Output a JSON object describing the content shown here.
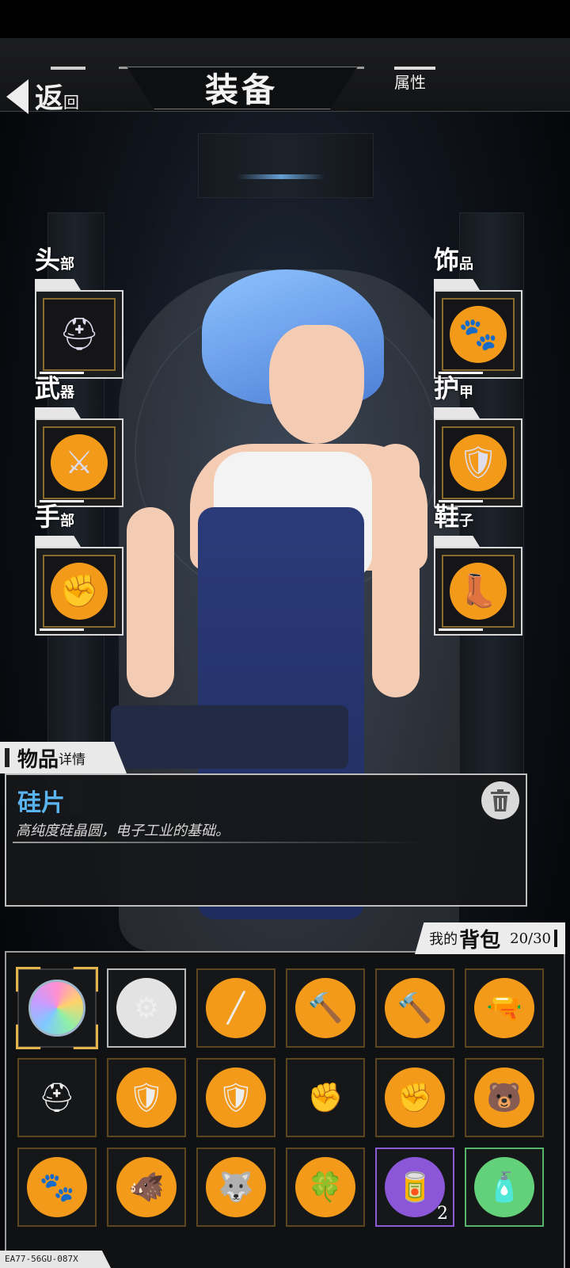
{
  "header": {
    "title": "装备",
    "back_big": "返",
    "back_small": "回",
    "attr_tab": "属性"
  },
  "slots": [
    {
      "big": "头",
      "small": "部",
      "icon_name": "helmet-icon",
      "orb": "none",
      "glyph": "⛑"
    },
    {
      "big": "武",
      "small": "器",
      "icon_name": "lightsaber-icon",
      "orb": "orange",
      "glyph": "⚔"
    },
    {
      "big": "手",
      "small": "部",
      "icon_name": "gauntlet-icon",
      "orb": "orange",
      "glyph": "✊"
    },
    {
      "big": "饰",
      "small": "品",
      "icon_name": "mole-charm-icon",
      "orb": "orange",
      "glyph": "🐾"
    },
    {
      "big": "护",
      "small": "甲",
      "icon_name": "armor-vest-icon",
      "orb": "orange",
      "glyph": "🛡"
    },
    {
      "big": "鞋",
      "small": "子",
      "icon_name": "boots-icon",
      "orb": "orange",
      "glyph": "👢"
    }
  ],
  "detail": {
    "tab_big": "物品",
    "tab_small": "详情",
    "name": "硅片",
    "description": "高纯度硅晶圆，电子工业的基础。"
  },
  "backpack": {
    "my": "我的",
    "label": "背包",
    "capacity": "20/30",
    "items": [
      {
        "icon_name": "silicon-wafer-icon",
        "rarity": "selected",
        "bg": "none",
        "glyph": "◉",
        "count": ""
      },
      {
        "icon_name": "scrap-metal-icon",
        "rarity": "grey",
        "bg": "grey",
        "glyph": "⚙",
        "count": ""
      },
      {
        "icon_name": "baton-icon",
        "rarity": "orange",
        "bg": "orange",
        "glyph": "╱",
        "count": ""
      },
      {
        "icon_name": "hammer-icon",
        "rarity": "orange",
        "bg": "orange",
        "glyph": "🔨",
        "count": ""
      },
      {
        "icon_name": "hammer-icon",
        "rarity": "orange",
        "bg": "orange",
        "glyph": "🔨",
        "count": ""
      },
      {
        "icon_name": "blaster-gun-icon",
        "rarity": "orange",
        "bg": "orange",
        "glyph": "🔫",
        "count": ""
      },
      {
        "icon_name": "helmet-icon",
        "rarity": "orange",
        "bg": "none",
        "glyph": "⛑",
        "count": ""
      },
      {
        "icon_name": "armor-vest-icon",
        "rarity": "orange",
        "bg": "orange",
        "glyph": "🛡",
        "count": ""
      },
      {
        "icon_name": "armor-vest-icon",
        "rarity": "orange",
        "bg": "orange",
        "glyph": "🛡",
        "count": ""
      },
      {
        "icon_name": "cyber-glove-icon",
        "rarity": "orange",
        "bg": "none",
        "glyph": "✊",
        "count": ""
      },
      {
        "icon_name": "gauntlet-icon",
        "rarity": "orange",
        "bg": "orange",
        "glyph": "✊",
        "count": ""
      },
      {
        "icon_name": "bear-charm-icon",
        "rarity": "orange",
        "bg": "orange",
        "glyph": "🐻",
        "count": ""
      },
      {
        "icon_name": "mole-charm-icon",
        "rarity": "orange",
        "bg": "orange",
        "glyph": "🐾",
        "count": ""
      },
      {
        "icon_name": "boar-charm-icon",
        "rarity": "orange",
        "bg": "orange",
        "glyph": "🐗",
        "count": ""
      },
      {
        "icon_name": "wolf-charm-icon",
        "rarity": "orange",
        "bg": "orange",
        "glyph": "🐺",
        "count": ""
      },
      {
        "icon_name": "clover-charm-icon",
        "rarity": "orange",
        "bg": "orange",
        "glyph": "🍀",
        "count": ""
      },
      {
        "icon_name": "canned-food-icon",
        "rarity": "purple",
        "bg": "purple",
        "glyph": "🥫",
        "count": "2"
      },
      {
        "icon_name": "water-bottle-icon",
        "rarity": "green",
        "bg": "green",
        "glyph": "🧴",
        "count": ""
      }
    ]
  },
  "footer_code": "EA77-56GU-087X",
  "colors": {
    "accent_orange": "#f39a1a",
    "name_blue": "#5ab4f0",
    "rare_purple": "#8b57d8",
    "common_green": "#63d07a"
  }
}
